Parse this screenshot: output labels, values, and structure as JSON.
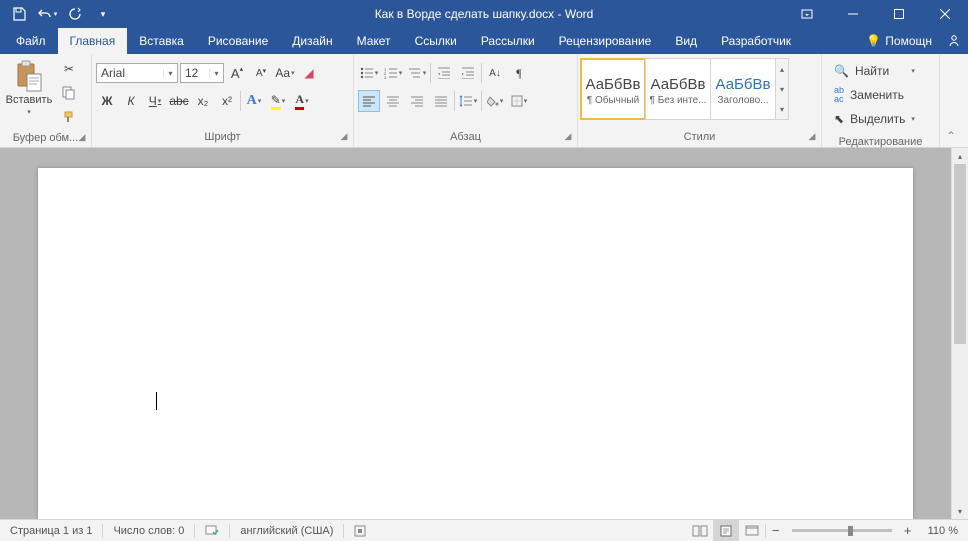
{
  "title": "Как в Ворде сделать шапку.docx  -  Word",
  "tabs": {
    "file": "Файл",
    "home": "Главная",
    "insert": "Вставка",
    "draw": "Рисование",
    "design": "Дизайн",
    "layout": "Макет",
    "references": "Ссылки",
    "mailings": "Рассылки",
    "review": "Рецензирование",
    "view": "Вид",
    "developer": "Разработчик",
    "tell": "Помощн"
  },
  "clipboard": {
    "paste": "Вставить",
    "label": "Буфер обм..."
  },
  "font": {
    "name": "Arial",
    "size": "12",
    "label": "Шрифт",
    "bold": "Ж",
    "italic": "К",
    "underline": "Ч",
    "strike": "abc",
    "sub": "x₂",
    "sup": "x²"
  },
  "paragraph": {
    "label": "Абзац"
  },
  "styles": {
    "label": "Стили",
    "items": [
      {
        "sample": "АаБбВв",
        "name": "¶ Обычный"
      },
      {
        "sample": "АаБбВв",
        "name": "¶ Без инте..."
      },
      {
        "sample": "АаБбВв",
        "name": "Заголово..."
      }
    ]
  },
  "editing": {
    "find": "Найти",
    "replace": "Заменить",
    "select": "Выделить",
    "label": "Редактирование"
  },
  "status": {
    "page": "Страница 1 из 1",
    "words": "Число слов: 0",
    "lang": "английский (США)",
    "zoom": "110 %"
  }
}
